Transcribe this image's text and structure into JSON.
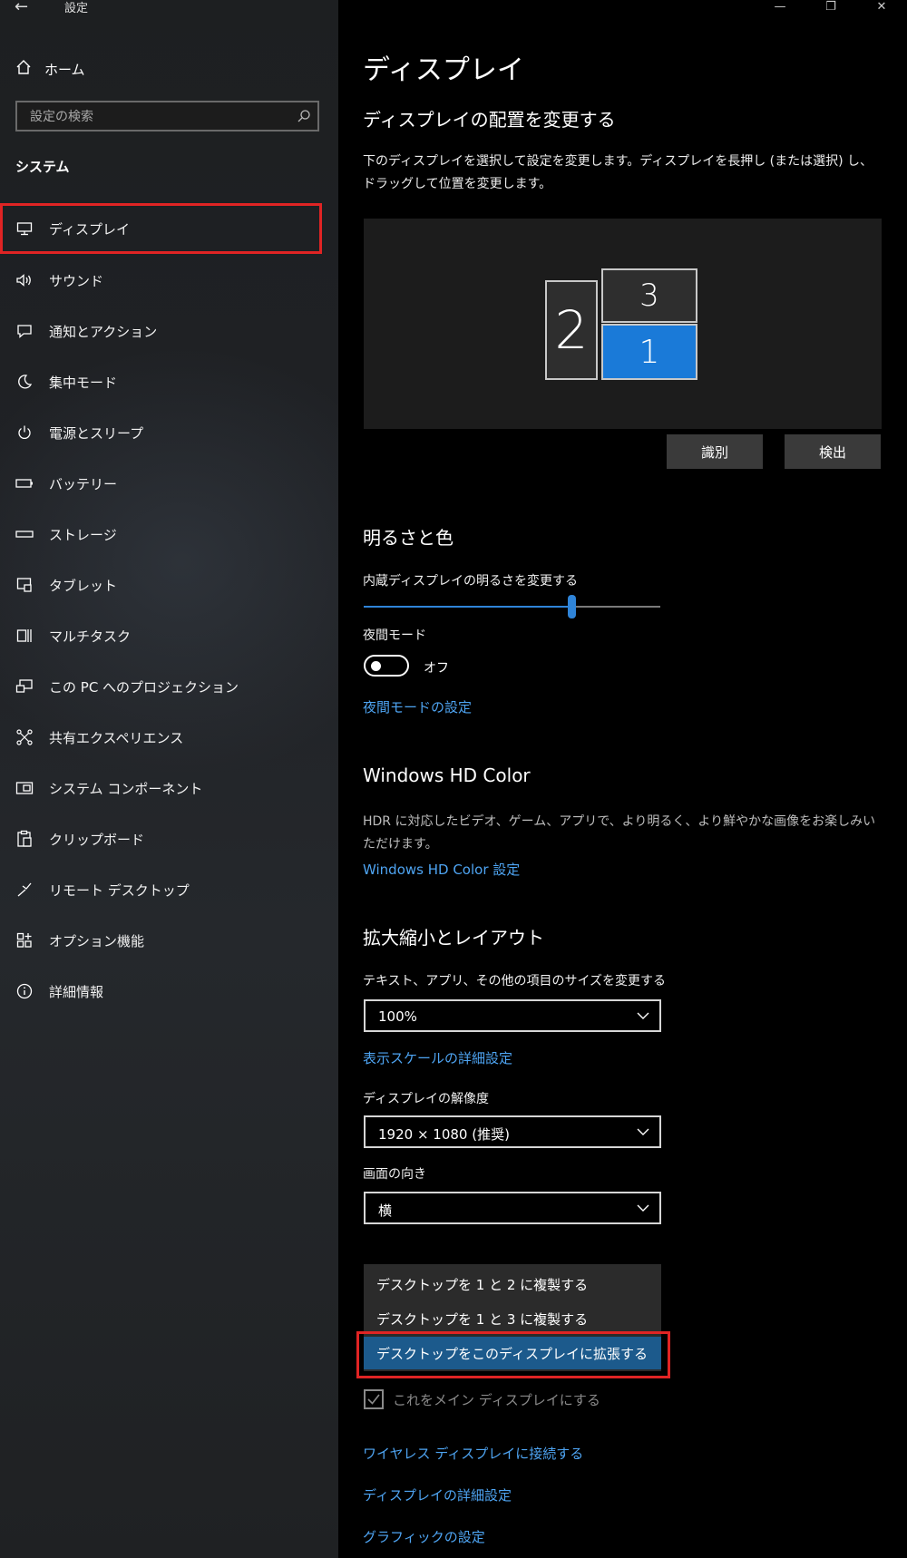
{
  "window": {
    "app_title": "設定",
    "minimize_glyph": "—",
    "restore_glyph": "❐",
    "close_glyph": "✕"
  },
  "sidebar": {
    "home_label": "ホーム",
    "search_placeholder": "設定の検索",
    "section_label": "システム",
    "items": [
      {
        "label": "ディスプレイ",
        "icon": "monitor-icon",
        "selected": true
      },
      {
        "label": "サウンド",
        "icon": "speaker-icon"
      },
      {
        "label": "通知とアクション",
        "icon": "notification-icon"
      },
      {
        "label": "集中モード",
        "icon": "moon-icon"
      },
      {
        "label": "電源とスリープ",
        "icon": "power-icon"
      },
      {
        "label": "バッテリー",
        "icon": "battery-icon"
      },
      {
        "label": "ストレージ",
        "icon": "storage-icon"
      },
      {
        "label": "タブレット",
        "icon": "tablet-icon"
      },
      {
        "label": "マルチタスク",
        "icon": "multitask-icon"
      },
      {
        "label": "この PC へのプロジェクション",
        "icon": "projection-icon"
      },
      {
        "label": "共有エクスペリエンス",
        "icon": "shared-experience-icon"
      },
      {
        "label": "システム コンポーネント",
        "icon": "components-icon"
      },
      {
        "label": "クリップボード",
        "icon": "clipboard-icon"
      },
      {
        "label": "リモート デスクトップ",
        "icon": "remote-desktop-icon"
      },
      {
        "label": "オプション機能",
        "icon": "optional-features-icon"
      },
      {
        "label": "詳細情報",
        "icon": "info-icon"
      }
    ]
  },
  "main": {
    "title": "ディスプレイ",
    "arrange": {
      "heading": "ディスプレイの配置を変更する",
      "description": "下のディスプレイを選択して設定を変更します。ディスプレイを長押し (または選択) し、ドラッグして位置を変更します。",
      "monitors": {
        "m1": "1",
        "m2": "2",
        "m3": "3"
      },
      "identify_button": "識別",
      "detect_button": "検出"
    },
    "brightness": {
      "heading": "明るさと色",
      "slider_label": "内蔵ディスプレイの明るさを変更する",
      "slider_value_fraction": 0.7,
      "night_mode_label": "夜間モード",
      "night_mode_state": "オフ",
      "night_mode_link": "夜間モードの設定"
    },
    "hd_color": {
      "heading": "Windows HD Color",
      "description": "HDR に対応したビデオ、ゲーム、アプリで、より明るく、より鮮やかな画像をお楽しみいただけます。",
      "link": "Windows HD Color 設定"
    },
    "scale_layout": {
      "heading": "拡大縮小とレイアウト",
      "size_label": "テキスト、アプリ、その他の項目のサイズを変更する",
      "size_value": "100%",
      "scale_link": "表示スケールの詳細設定",
      "resolution_label": "ディスプレイの解像度",
      "resolution_value": "1920 × 1080 (推奨)",
      "orientation_label": "画面の向き",
      "orientation_value": "横"
    },
    "multi_display": {
      "options": [
        "デスクトップを 1 と 2 に複製する",
        "デスクトップを 1 と 3 に複製する",
        "デスクトップをこのディスプレイに拡張する"
      ],
      "make_main_label": "これをメイン ディスプレイにする"
    },
    "links": {
      "wireless": "ワイヤレス ディスプレイに接続する",
      "advanced": "ディスプレイの詳細設定",
      "graphics": "グラフィックの設定"
    }
  },
  "colors": {
    "accent": "#1a7ad8",
    "link": "#4ea4f2",
    "highlight_red": "#e02424",
    "menu_selected": "#1c5a8c"
  }
}
